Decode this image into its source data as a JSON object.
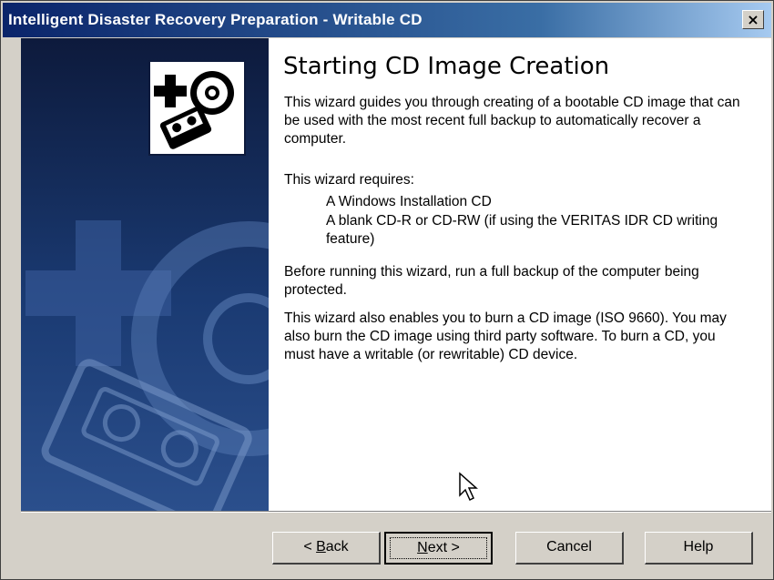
{
  "window": {
    "title": "Intelligent Disaster Recovery Preparation - Writable CD",
    "close_label": "×"
  },
  "main": {
    "heading": "Starting CD Image Creation",
    "intro": "This wizard guides you through creating of a bootable CD image that can be used with the most recent full backup to automatically recover a computer.",
    "requires_label": "This wizard requires:",
    "requirements": [
      "A Windows Installation CD",
      "A blank CD-R or CD-RW (if using the VERITAS IDR CD writing feature)"
    ],
    "before_text": "Before running this wizard, run a full backup of the computer being protected.",
    "burn_text": "This wizard also enables you to burn a CD image (ISO 9660). You may also burn the CD image using third party software. To burn a CD, you must have a writable (or rewritable) CD device."
  },
  "buttons": {
    "back_prefix": "< ",
    "back_mnemonic": "B",
    "back_rest": "ack",
    "next_mnemonic": "N",
    "next_rest": "ext >",
    "cancel": "Cancel",
    "help": "Help"
  },
  "colors": {
    "title_bar_start": "#0a246a",
    "title_bar_end": "#a6caf0",
    "panel_dark": "#0d1a3c",
    "dialog_face": "#d4d0c8"
  },
  "icons": {
    "logo": "backup-logo-icon",
    "cursor": "mouse-pointer-icon"
  }
}
